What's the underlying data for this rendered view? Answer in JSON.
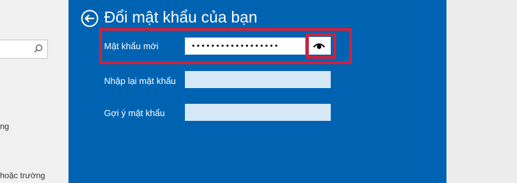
{
  "background_panel": {
    "search": {
      "placeholder": ""
    },
    "items": [
      {
        "label": "ng"
      },
      {
        "label": "hoặc trường"
      }
    ]
  },
  "dialog": {
    "title": "Đổi mật khẩu của bạn",
    "fields": [
      {
        "label": "Mật khẩu mới",
        "value": "••••••••••••••••••",
        "active": true
      },
      {
        "label": "Nhập lại mật khẩu",
        "value": ""
      },
      {
        "label": "Gợi ý mật khẩu",
        "value": ""
      }
    ],
    "reveal_icon": "eye-icon",
    "back_icon": "back-arrow-icon"
  },
  "colors": {
    "dialog_bg": "#0063b1",
    "highlight": "#d3203a",
    "input_inactive": "#d6e7f7",
    "text": "#ffffff"
  }
}
